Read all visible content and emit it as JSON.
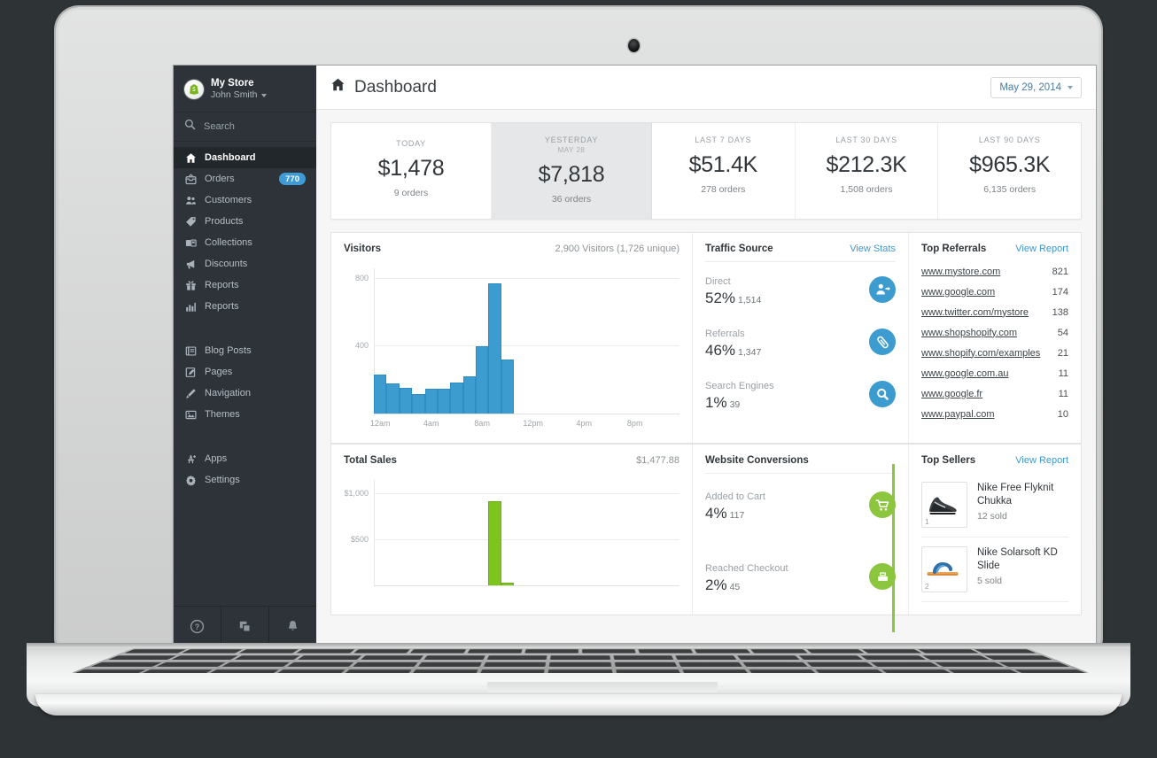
{
  "sidebar": {
    "store_name": "My Store",
    "user_name": "John Smith",
    "search_label": "Search",
    "items": [
      {
        "label": "Dashboard",
        "icon": "home-icon",
        "active": true
      },
      {
        "label": "Orders",
        "icon": "orders-icon",
        "badge": "770"
      },
      {
        "label": "Customers",
        "icon": "customers-icon"
      },
      {
        "label": "Products",
        "icon": "tag-icon"
      },
      {
        "label": "Collections",
        "icon": "collections-icon"
      },
      {
        "label": "Discounts",
        "icon": "megaphone-icon"
      },
      {
        "label": "Reports",
        "icon": "bar-chart-icon"
      }
    ],
    "items2": [
      {
        "label": "Blog Posts",
        "icon": "blog-icon"
      },
      {
        "label": "Pages",
        "icon": "pages-icon"
      },
      {
        "label": "Navigation",
        "icon": "navigation-icon"
      },
      {
        "label": "Themes",
        "icon": "themes-icon"
      }
    ],
    "items3": [
      {
        "label": "Apps",
        "icon": "apps-icon"
      },
      {
        "label": "Settings",
        "icon": "gear-icon"
      }
    ],
    "footer_icons": [
      "help-icon",
      "windows-icon",
      "bell-icon"
    ]
  },
  "header": {
    "title": "Dashboard",
    "title_icon": "home-icon",
    "date_range": "May 29, 2014",
    "date_caret_icon": "chevron-down-icon"
  },
  "kpis": [
    {
      "label": "TODAY",
      "sublabel": "",
      "value": "$1,478",
      "orders": "9 orders"
    },
    {
      "label": "YESTERDAY",
      "sublabel": "MAY 28",
      "value": "$7,818",
      "orders": "36 orders"
    },
    {
      "label": "LAST 7 DAYS",
      "sublabel": "",
      "value": "$51.4K",
      "orders": "278 orders"
    },
    {
      "label": "LAST 30 DAYS",
      "sublabel": "",
      "value": "$212.3K",
      "orders": "1,508 orders"
    },
    {
      "label": "LAST 90 DAYS",
      "sublabel": "",
      "value": "$965.3K",
      "orders": "6,135 orders"
    }
  ],
  "visitors": {
    "title": "Visitors",
    "meta": "2,900 Visitors (1,726 unique)"
  },
  "traffic_source": {
    "title": "Traffic Source",
    "link": "View Stats",
    "rows": [
      {
        "name": "Direct",
        "percent": "52%",
        "count": "1,514",
        "icon": "direct-visitor-icon"
      },
      {
        "name": "Referrals",
        "percent": "46%",
        "count": "1,347",
        "icon": "link-icon"
      },
      {
        "name": "Search Engines",
        "percent": "1%",
        "count": "39",
        "icon": "search-icon"
      }
    ]
  },
  "top_referrals": {
    "title": "Top Referrals",
    "link": "View Report",
    "rows": [
      {
        "url": "www.mystore.com",
        "value": "821"
      },
      {
        "url": "www.google.com",
        "value": "174"
      },
      {
        "url": "www.twitter.com/mystore",
        "value": "138"
      },
      {
        "url": "www.shopshopify.com",
        "value": "54"
      },
      {
        "url": "www.shopify.com/examples",
        "value": "21"
      },
      {
        "url": "www.google.com.au",
        "value": "11"
      },
      {
        "url": "www.google.fr",
        "value": "11"
      },
      {
        "url": "www.paypal.com",
        "value": "10"
      }
    ]
  },
  "total_sales": {
    "title": "Total Sales",
    "meta": "$1,477.88"
  },
  "conversions": {
    "title": "Website Conversions",
    "rows": [
      {
        "name": "Added to Cart",
        "percent": "4%",
        "count": "117",
        "icon": "cart-icon"
      },
      {
        "name": "Reached Checkout",
        "percent": "2%",
        "count": "45",
        "icon": "checkout-icon"
      }
    ]
  },
  "top_sellers": {
    "title": "Top Sellers",
    "link": "View Report",
    "rows": [
      {
        "rank": "1",
        "name": "Nike Free Flyknit Chukka",
        "sold": "12 sold"
      },
      {
        "rank": "2",
        "name": "Nike Solarsoft KD Slide",
        "sold": "5 sold"
      }
    ]
  },
  "colors": {
    "accent_blue": "#3d9ccf",
    "accent_green": "#8cc63f",
    "sidebar_bg": "#2d3339",
    "link": "#3e97d1"
  },
  "chart_data": [
    {
      "type": "bar",
      "title": "Visitors",
      "xlabel": "",
      "ylabel": "",
      "ylim": [
        0,
        860
      ],
      "yticks": [
        400,
        800
      ],
      "ytick_labels": [
        "400",
        "800"
      ],
      "grid": true,
      "x": [
        "12am",
        "1am",
        "2am",
        "3am",
        "4am",
        "5am",
        "6am",
        "7am",
        "8am",
        "9am",
        "10am",
        "11am",
        "12pm",
        "1pm",
        "2pm",
        "3pm",
        "4pm",
        "5pm",
        "6pm",
        "7pm",
        "8pm",
        "9pm",
        "10pm",
        "11pm"
      ],
      "xtick_labels": [
        "12am",
        "4am",
        "8am",
        "12pm",
        "4pm",
        "8pm"
      ],
      "values": [
        232,
        178,
        152,
        118,
        148,
        148,
        182,
        222,
        400,
        770,
        320,
        0,
        0,
        0,
        0,
        0,
        0,
        0,
        0,
        0,
        0,
        0,
        0,
        0
      ],
      "series_color": "#3d9ccf",
      "annotation": "2,900 Visitors (1,726 unique)"
    },
    {
      "type": "bar",
      "title": "Total Sales",
      "xlabel": "",
      "ylabel": "",
      "ylim": [
        0,
        1150
      ],
      "yticks": [
        500,
        1000
      ],
      "ytick_labels": [
        "$500",
        "$1,000"
      ],
      "grid": true,
      "x": [
        "12am",
        "1am",
        "2am",
        "3am",
        "4am",
        "5am",
        "6am",
        "7am",
        "8am",
        "9am",
        "10am",
        "11am",
        "12pm",
        "1pm",
        "2pm",
        "3pm",
        "4pm",
        "5pm",
        "6pm",
        "7pm",
        "8pm",
        "9pm",
        "10pm",
        "11pm"
      ],
      "values": [
        0,
        0,
        0,
        0,
        0,
        0,
        0,
        0,
        0,
        915,
        25,
        0,
        0,
        0,
        0,
        0,
        0,
        0,
        0,
        0,
        0,
        0,
        0,
        0
      ],
      "series_color": "#7dc41e",
      "annotation": "$1,477.88"
    },
    {
      "type": "bar",
      "title": "Traffic Source",
      "categories": [
        "Direct",
        "Referrals",
        "Search Engines"
      ],
      "values": [
        1514,
        1347,
        39
      ],
      "percents": [
        52,
        46,
        1
      ]
    },
    {
      "type": "bar",
      "title": "Website Conversions",
      "categories": [
        "Added to Cart",
        "Reached Checkout"
      ],
      "values": [
        117,
        45
      ],
      "percents": [
        4,
        2
      ]
    },
    {
      "type": "table",
      "title": "Top Referrals",
      "categories": [
        "www.mystore.com",
        "www.google.com",
        "www.twitter.com/mystore",
        "www.shopshopify.com",
        "www.shopify.com/examples",
        "www.google.com.au",
        "www.google.fr",
        "www.paypal.com"
      ],
      "values": [
        821,
        174,
        138,
        54,
        21,
        11,
        11,
        10
      ]
    }
  ]
}
